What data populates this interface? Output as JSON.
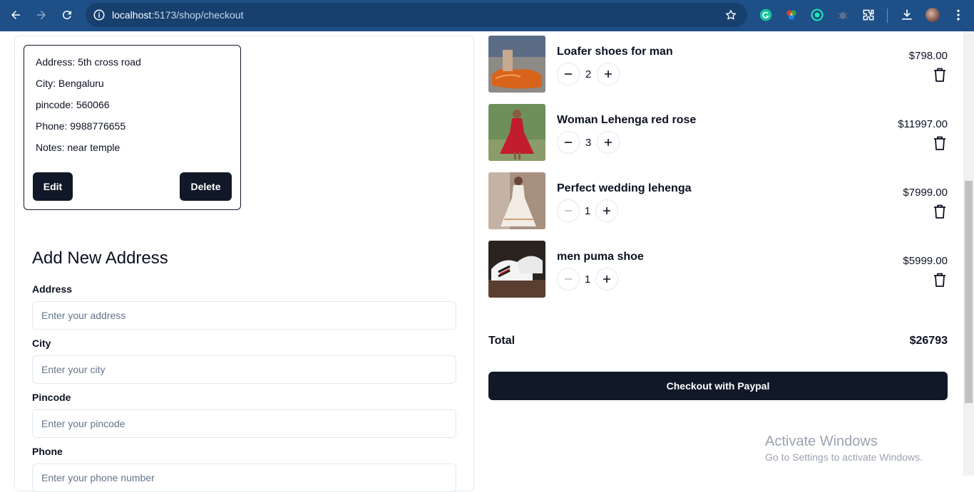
{
  "browser": {
    "url_host": "localhost",
    "url_rest": ":5173/shop/checkout"
  },
  "address_card": {
    "address": "Address: 5th cross road",
    "city": "City: Bengaluru",
    "pincode": "pincode: 560066",
    "phone": "Phone: 9988776655",
    "notes": "Notes: near temple",
    "edit_label": "Edit",
    "delete_label": "Delete"
  },
  "form": {
    "title": "Add New Address",
    "fields": [
      {
        "label": "Address",
        "placeholder": "Enter your address"
      },
      {
        "label": "City",
        "placeholder": "Enter your city"
      },
      {
        "label": "Pincode",
        "placeholder": "Enter your pincode"
      },
      {
        "label": "Phone",
        "placeholder": "Enter your phone number"
      }
    ]
  },
  "cart": {
    "items": [
      {
        "title": "Loafer shoes for man",
        "qty": "2",
        "price": "$798.00",
        "image": "orange-loafer-shoes"
      },
      {
        "title": "Woman Lehenga red rose",
        "qty": "3",
        "price": "$11997.00",
        "image": "red-dress"
      },
      {
        "title": "Perfect wedding lehenga",
        "qty": "1",
        "price": "$7999.00",
        "image": "white-lehenga"
      },
      {
        "title": "men puma shoe",
        "qty": "1",
        "price": "$5999.00",
        "image": "white-sneakers"
      }
    ],
    "total_label": "Total",
    "total_value": "$26793",
    "checkout_label": "Checkout with Paypal"
  },
  "watermark": {
    "title": "Activate Windows",
    "subtitle": "Go to Settings to activate Windows."
  },
  "colors": {
    "chrome": "#1e4f86",
    "primary": "#111827"
  }
}
